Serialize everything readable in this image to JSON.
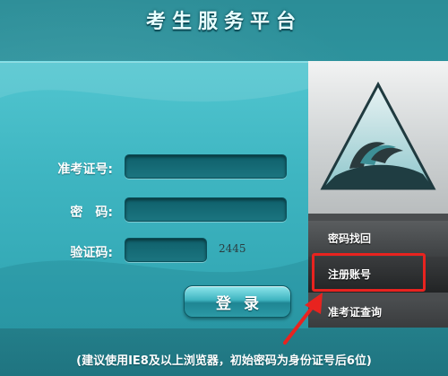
{
  "page": {
    "title": "考生服务平台"
  },
  "login": {
    "ticket_label": "准考证号:",
    "password_label": "密　码:",
    "captcha_label": "验证码:",
    "ticket_value": "",
    "password_value": "",
    "captcha_value": "",
    "captcha_text": "2445",
    "submit_label": "登录"
  },
  "sidebar": {
    "items": [
      {
        "label": "密码找回"
      },
      {
        "label": "注册账号"
      },
      {
        "label": "准考证查询"
      }
    ]
  },
  "footer": {
    "note": "(建议使用IE8及以上浏览器，初始密码为身份证号后6位)"
  },
  "colors": {
    "accent": "#2fa3b0",
    "highlight": "#e8231f",
    "sidebar": "#4a4d4f"
  },
  "icons": {
    "logo": "triangle-flame-logo-icon",
    "arrow": "red-arrow-icon"
  }
}
